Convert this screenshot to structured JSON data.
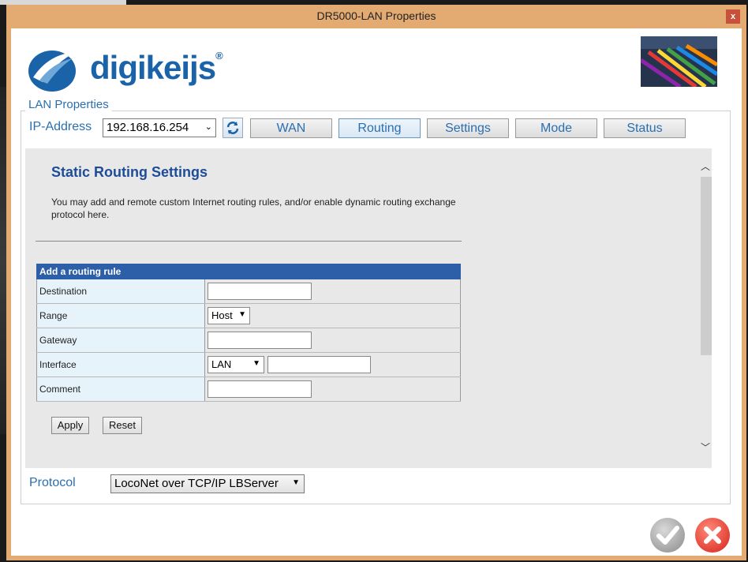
{
  "window": {
    "title": "DR5000-LAN Properties",
    "close_glyph": "x"
  },
  "brand": {
    "logo_text": "digikeijs",
    "registered": "®"
  },
  "group": {
    "label": "LAN Properties"
  },
  "ip": {
    "label": "IP-Address",
    "value": "192.168.16.254"
  },
  "tabs": [
    {
      "label": "WAN"
    },
    {
      "label": "Routing"
    },
    {
      "label": "Settings"
    },
    {
      "label": "Mode"
    },
    {
      "label": "Status"
    }
  ],
  "routing": {
    "title": "Static Routing Settings",
    "description": "You may add and remote custom Internet routing rules, and/or enable dynamic routing exchange protocol here.",
    "table_header": "Add a routing rule",
    "rows": {
      "destination": "Destination",
      "range": "Range",
      "gateway": "Gateway",
      "interface": "Interface",
      "comment": "Comment"
    },
    "range_value": "Host",
    "interface_value": "LAN",
    "apply_label": "Apply",
    "reset_label": "Reset"
  },
  "protocol": {
    "label": "Protocol",
    "value": "LocoNet over TCP/IP LBServer"
  },
  "colors": {
    "accent": "#2a6fb0",
    "title_bar": "#e3ab72",
    "table_header": "#2d5ea8"
  }
}
